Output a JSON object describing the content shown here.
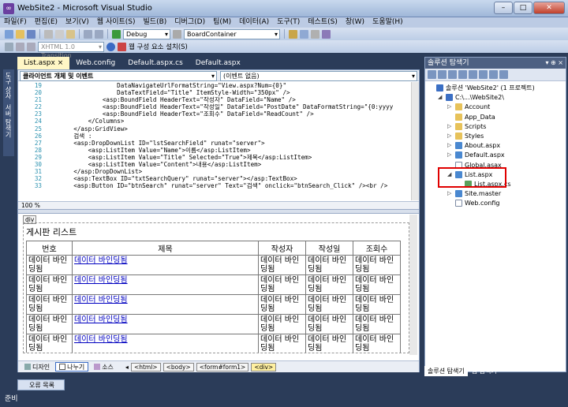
{
  "window": {
    "title": "WebSite2 - Microsoft Visual Studio"
  },
  "menu": [
    "파일(F)",
    "편집(E)",
    "보기(V)",
    "웹 사이트(S)",
    "빌드(B)",
    "디버그(D)",
    "팀(M)",
    "데이터(A)",
    "도구(T)",
    "테스트(S)",
    "창(W)",
    "도움말(H)"
  ],
  "toolbar": {
    "config": "Debug",
    "startup": "BoardContainer",
    "schema": "XHTML 1.0 Transition",
    "webparts": "웹 구성 요소 설치(S)"
  },
  "tabs": [
    "List.aspx",
    "Web.config",
    "Default.aspx.cs",
    "Default.aspx"
  ],
  "leftrail": [
    "도구 상자",
    "서버 탐색기"
  ],
  "editor_nav": {
    "left": "클라이언트 개체 및 이벤트",
    "right": "(이벤트 없음)"
  },
  "code_lines": [
    {
      "n": "19",
      "t": "                DataNavigateUrlFormatString=\"View.aspx?Num={0}\""
    },
    {
      "n": "20",
      "t": "                DataTextField=\"Title\" ItemStyle-Width=\"350px\" />"
    },
    {
      "n": "21",
      "t": "            <asp:BoundField HeaderText=\"작성자\" DataField=\"Name\" />"
    },
    {
      "n": "22",
      "t": "            <asp:BoundField HeaderText=\"작성일\" DataField=\"PostDate\" DataFormatString=\"{0:yyyy"
    },
    {
      "n": "23",
      "t": "            <asp:BoundField HeaderText=\"조회수\" DataField=\"ReadCount\" />"
    },
    {
      "n": "24",
      "t": "        </Columns>"
    },
    {
      "n": "25",
      "t": "    </asp:GridView>"
    },
    {
      "n": "26",
      "t": "    검색 :"
    },
    {
      "n": "27",
      "t": "    <asp:DropDownList ID=\"lstSearchField\" runat=\"server\">"
    },
    {
      "n": "28",
      "t": "        <asp:ListItem Value=\"Name\">이름</asp:ListItem>"
    },
    {
      "n": "29",
      "t": "        <asp:ListItem Value=\"Title\" Selected=\"True\">제목</asp:ListItem>"
    },
    {
      "n": "30",
      "t": "        <asp:ListItem Value=\"Content\">내용</asp:ListItem>"
    },
    {
      "n": "31",
      "t": "    </asp:DropDownList>"
    },
    {
      "n": "32",
      "t": "    <asp:TextBox ID=\"txtSearchQuery\" runat=\"server\"></asp:TextBox>"
    },
    {
      "n": "33",
      "t": "    <asp:Button ID=\"btnSearch\" runat=\"server\" Text=\"검색\" onclick=\"btnSearch_Click\" /><br />"
    }
  ],
  "zoom": "100 %",
  "design": {
    "div_tag": "div",
    "title": "게시판 리스트",
    "headers": [
      "번호",
      "제목",
      "작성자",
      "작성일",
      "조회수"
    ],
    "cell_text": "데이터 바인딩됨",
    "link_text": "데이터 바인딩됨",
    "rows": 5,
    "search_label": "검색"
  },
  "viewbar": {
    "design": "디자인",
    "split": "나누기",
    "source": "소스",
    "crumbs": [
      "<html>",
      "<body>",
      "<form#form1>",
      "<div>"
    ]
  },
  "solution": {
    "title": "솔루션 탐색기",
    "controls": "▾ ⊕ ×",
    "items": [
      {
        "label": "솔루션 'WebSite2' (1 프로젝트)",
        "indent": 0,
        "icon": "proj",
        "exp": ""
      },
      {
        "label": "C:\\...\\WebSite2\\",
        "indent": 1,
        "icon": "proj",
        "exp": "◢"
      },
      {
        "label": "Account",
        "indent": 2,
        "icon": "folder",
        "exp": "▷"
      },
      {
        "label": "App_Data",
        "indent": 2,
        "icon": "folder",
        "exp": ""
      },
      {
        "label": "Scripts",
        "indent": 2,
        "icon": "folder",
        "exp": "▷"
      },
      {
        "label": "Styles",
        "indent": 2,
        "icon": "folder",
        "exp": "▷"
      },
      {
        "label": "About.aspx",
        "indent": 2,
        "icon": "webfile",
        "exp": "▷"
      },
      {
        "label": "Default.aspx",
        "indent": 2,
        "icon": "webfile",
        "exp": "▷"
      },
      {
        "label": "Global.asax",
        "indent": 2,
        "icon": "file",
        "exp": ""
      },
      {
        "label": "List.aspx",
        "indent": 2,
        "icon": "webfile",
        "exp": "◢"
      },
      {
        "label": "List.aspx.cs",
        "indent": 3,
        "icon": "csfile",
        "exp": ""
      },
      {
        "label": "Site.master",
        "indent": 2,
        "icon": "webfile",
        "exp": "▷"
      },
      {
        "label": "Web.config",
        "indent": 2,
        "icon": "file",
        "exp": ""
      }
    ],
    "tabs": [
      "솔루션 탐색기",
      "팀 탐색기"
    ]
  },
  "error_list": "오류 목록",
  "status": "준비"
}
